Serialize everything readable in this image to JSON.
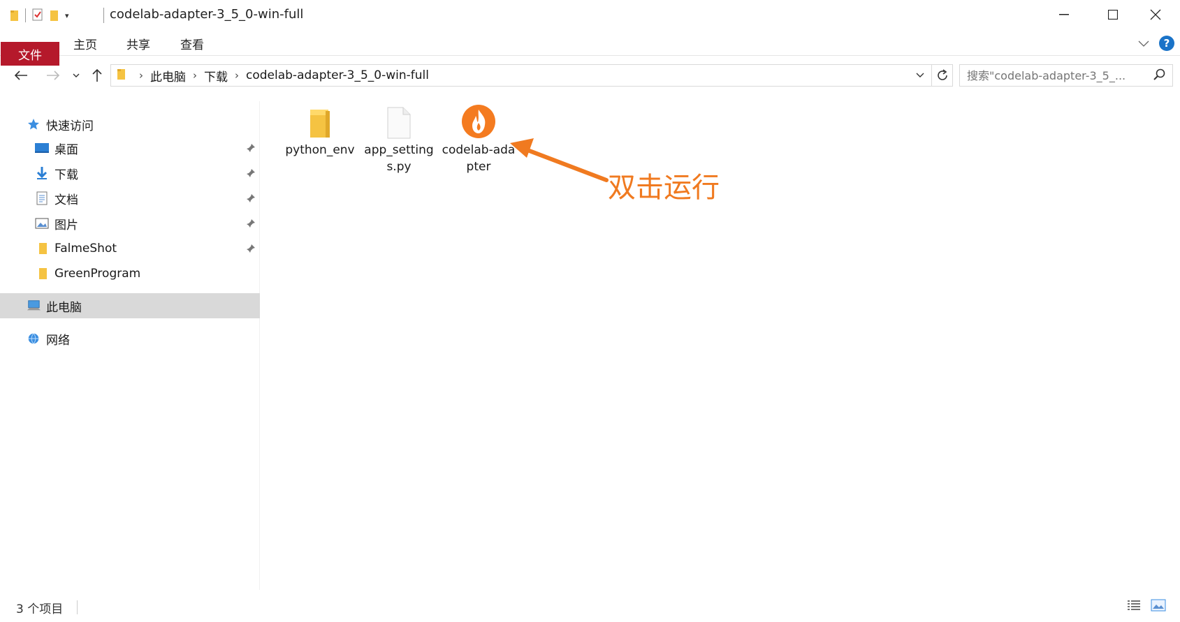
{
  "window": {
    "title": "codelab-adapter-3_5_0-win-full"
  },
  "ribbon": {
    "tabs": [
      "文件",
      "主页",
      "共享",
      "查看"
    ]
  },
  "address": {
    "crumbs": [
      "此电脑",
      "下载",
      "codelab-adapter-3_5_0-win-full"
    ]
  },
  "search": {
    "placeholder": "搜索\"codelab-adapter-3_5_..."
  },
  "sidebar": {
    "quick_access": "快速访问",
    "items": [
      {
        "label": "桌面",
        "icon": "desktop-icon",
        "pinned": true
      },
      {
        "label": "下载",
        "icon": "download-icon",
        "pinned": true
      },
      {
        "label": "文档",
        "icon": "document-icon",
        "pinned": true
      },
      {
        "label": "图片",
        "icon": "picture-icon",
        "pinned": true
      },
      {
        "label": "FalmeShot",
        "icon": "folder-icon",
        "pinned": true
      },
      {
        "label": "GreenProgram",
        "icon": "folder-icon",
        "pinned": false
      }
    ],
    "this_pc": "此电脑",
    "network": "网络"
  },
  "files": [
    {
      "name": "python_env",
      "icon": "folder-icon"
    },
    {
      "name": "app_settings.py",
      "icon": "file-icon"
    },
    {
      "name": "codelab-adapter",
      "icon": "flame-app-icon"
    }
  ],
  "annotation": {
    "text": "双击运行",
    "color": "#f07a20"
  },
  "status": {
    "count": "3 个项目"
  },
  "colors": {
    "file_tab": "#b5192b",
    "selected_nav": "#d9d9d9",
    "help": "#1a73c8"
  }
}
